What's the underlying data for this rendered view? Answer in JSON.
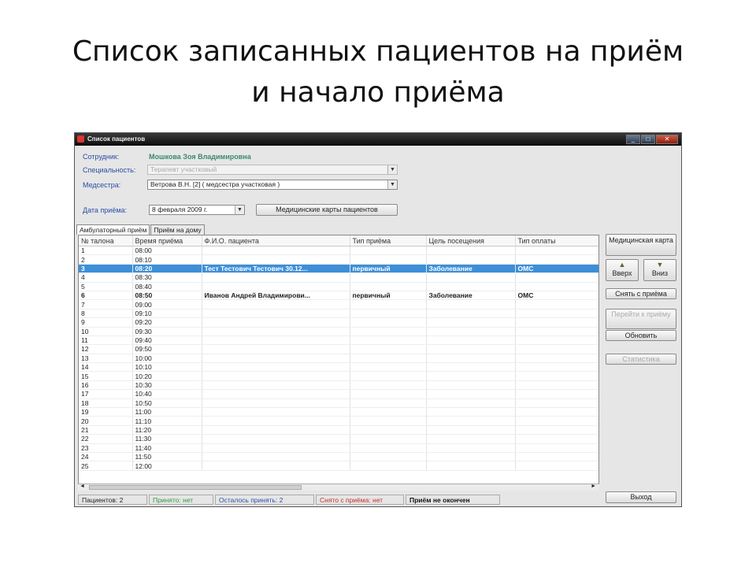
{
  "slide": {
    "title_line1": "Список записанных пациентов на приём",
    "title_line2": "и начало приёма"
  },
  "window": {
    "title": "Список пациентов",
    "controls": {
      "minimize": "_",
      "maximize": "□",
      "close": "✕"
    }
  },
  "form": {
    "employee_label": "Сотрудник:",
    "employee_value": "Мошкова Зоя Владимировна",
    "specialty_label": "Специальность:",
    "specialty_value": "Терапевт участковый",
    "nurse_label": "Медсестра:",
    "nurse_value": "Ветрова В.Н.  [2]   ( медсестра участковая )",
    "date_label": "Дата приёма:",
    "date_value": "8 февраля 2009 г.",
    "records_button": "Медицинские карты пациентов"
  },
  "tabs": [
    "Амбулаторный приём",
    "Приём на дому"
  ],
  "table": {
    "columns": [
      "№ талона",
      "Время приёма",
      "Ф.И.О. пациента",
      "Тип приёма",
      "Цель посещения",
      "Тип оплаты"
    ],
    "rows": [
      [
        "1",
        "08:00",
        "",
        "",
        "",
        ""
      ],
      [
        "2",
        "08:10",
        "",
        "",
        "",
        ""
      ],
      [
        "3",
        "08:20",
        "Тест Тестович Тестович 30.12...",
        "первичный",
        "Заболевание",
        "ОМС"
      ],
      [
        "4",
        "08:30",
        "",
        "",
        "",
        ""
      ],
      [
        "5",
        "08:40",
        "",
        "",
        "",
        ""
      ],
      [
        "6",
        "08:50",
        "Иванов Андрей Владимирови...",
        "первичный",
        "Заболевание",
        "ОМС"
      ],
      [
        "7",
        "09:00",
        "",
        "",
        "",
        ""
      ],
      [
        "8",
        "09:10",
        "",
        "",
        "",
        ""
      ],
      [
        "9",
        "09:20",
        "",
        "",
        "",
        ""
      ],
      [
        "10",
        "09:30",
        "",
        "",
        "",
        ""
      ],
      [
        "11",
        "09:40",
        "",
        "",
        "",
        ""
      ],
      [
        "12",
        "09:50",
        "",
        "",
        "",
        ""
      ],
      [
        "13",
        "10:00",
        "",
        "",
        "",
        ""
      ],
      [
        "14",
        "10:10",
        "",
        "",
        "",
        ""
      ],
      [
        "15",
        "10:20",
        "",
        "",
        "",
        ""
      ],
      [
        "16",
        "10:30",
        "",
        "",
        "",
        ""
      ],
      [
        "17",
        "10:40",
        "",
        "",
        "",
        ""
      ],
      [
        "18",
        "10:50",
        "",
        "",
        "",
        ""
      ],
      [
        "19",
        "11:00",
        "",
        "",
        "",
        ""
      ],
      [
        "20",
        "11:10",
        "",
        "",
        "",
        ""
      ],
      [
        "21",
        "11:20",
        "",
        "",
        "",
        ""
      ],
      [
        "22",
        "11:30",
        "",
        "",
        "",
        ""
      ],
      [
        "23",
        "11:40",
        "",
        "",
        "",
        ""
      ],
      [
        "24",
        "11:50",
        "",
        "",
        "",
        ""
      ],
      [
        "25",
        "12:00",
        "",
        "",
        "",
        ""
      ]
    ],
    "selected_row": 2,
    "bold_row": 5
  },
  "side_buttons": {
    "medical_card": "Медицинская карта",
    "up": "Вверх",
    "down": "Вниз",
    "remove": "Снять с приёма",
    "goto": "Перейти к приёму",
    "refresh": "Обновить",
    "stats": "Статистика",
    "exit": "Выход"
  },
  "status": {
    "patients": "Пациентов: 2",
    "accepted": "Принято: нет",
    "remaining": "Осталось принять: 2",
    "removed": "Снято с приёма: нет",
    "state": "Приём не окончен"
  },
  "colors": {
    "selection": "#3d8fd8",
    "label_blue": "#2b4da8",
    "employee_green": "#3a8a6b",
    "status_green": "#2e9a3a",
    "status_blue": "#2b4da8",
    "status_red": "#c0302a"
  }
}
